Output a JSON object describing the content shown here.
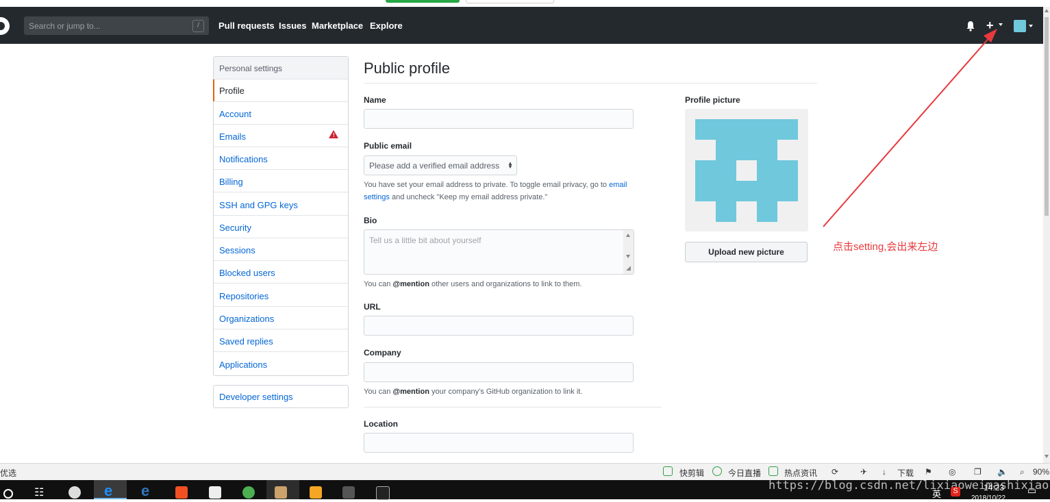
{
  "header": {
    "search_placeholder": "Search or jump to...",
    "search_shortcut": "/",
    "nav": [
      "Pull requests",
      "Issues",
      "Marketplace",
      "Explore"
    ]
  },
  "sidebar": {
    "heading": "Personal settings",
    "items": [
      "Profile",
      "Account",
      "Emails",
      "Notifications",
      "Billing",
      "SSH and GPG keys",
      "Security",
      "Sessions",
      "Blocked users",
      "Repositories",
      "Organizations",
      "Saved replies",
      "Applications"
    ],
    "active": "Profile",
    "developer": "Developer settings"
  },
  "main": {
    "title": "Public profile",
    "name_label": "Name",
    "email_label": "Public email",
    "email_select": "Please add a verified email address",
    "email_note_1": "You have set your email address to private. To toggle email privacy, go to",
    "email_note_link_1": "email",
    "email_note_link_2": "settings",
    "email_note_2": "and uncheck \"Keep my email address private.\"",
    "bio_label": "Bio",
    "bio_placeholder": "Tell us a little bit about yourself",
    "bio_note_pre": "You can",
    "bio_note_mention": "@mention",
    "bio_note_post": "other users and organizations to link to them.",
    "url_label": "URL",
    "company_label": "Company",
    "company_note_pre": "You can",
    "company_note_mention": "@mention",
    "company_note_post": "your company's GitHub organization to link it.",
    "location_label": "Location"
  },
  "profile_picture": {
    "label": "Profile picture",
    "upload_button": "Upload new picture",
    "identicon_color": "#6fc8dc"
  },
  "annotation": {
    "text": "点击setting,会出来左边",
    "color": "#e8393c"
  },
  "statusbar": {
    "left": "优选",
    "items": [
      "快剪辑",
      "今日直播",
      "热点资讯",
      "下载"
    ],
    "zoom": "90%"
  },
  "taskbar": {
    "watermark": "https://blog.csdn.net/lixiaoweimashixiao",
    "time": "14:23",
    "date": "2018/10/22",
    "ime": "英"
  },
  "colors": {
    "header_bg": "#24292e",
    "link": "#0366d6",
    "active_accent": "#e36209",
    "warning": "#cb2431"
  }
}
